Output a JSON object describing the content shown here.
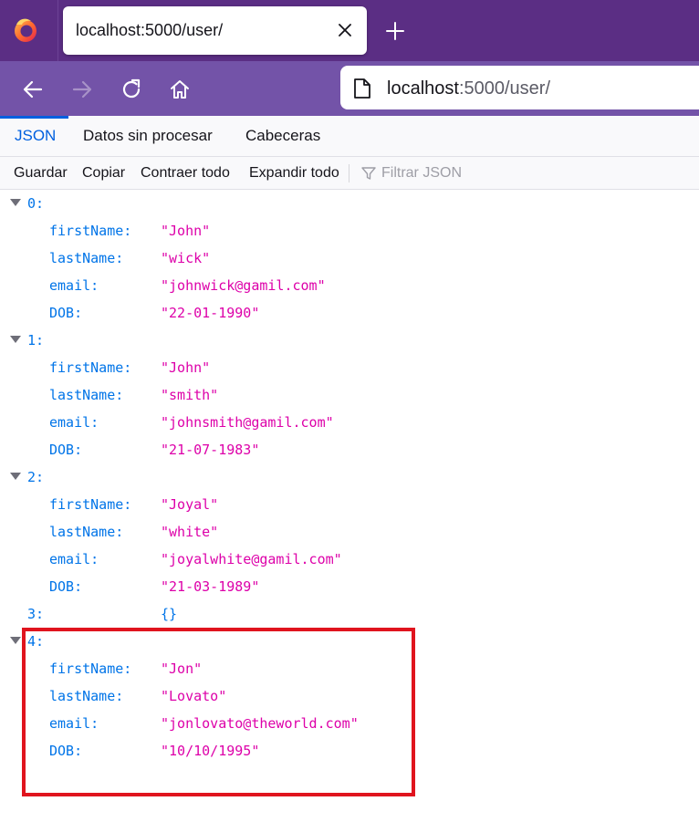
{
  "browser": {
    "tab_title": "localhost:5000/user/",
    "url_host": "localhost",
    "url_rest": ":5000/user/",
    "colors": {
      "tabbar": "#5b2e84",
      "navbar": "#7353a8",
      "accent": "#0060df"
    }
  },
  "json_viewer": {
    "tabs": [
      {
        "label": "JSON",
        "active": true
      },
      {
        "label": "Datos sin procesar",
        "active": false
      },
      {
        "label": "Cabeceras",
        "active": false
      }
    ],
    "toolbar": {
      "save": "Guardar",
      "copy": "Copiar",
      "collapse_all": "Contraer todo",
      "expand_all": "Expandir todo",
      "filter_placeholder": "Filtrar JSON"
    },
    "rows": [
      {
        "type": "index",
        "label": "0:"
      },
      {
        "type": "field",
        "key": "firstName:",
        "value": "\"John\""
      },
      {
        "type": "field",
        "key": "lastName:",
        "value": "\"wick\""
      },
      {
        "type": "field",
        "key": "email:",
        "value": "\"johnwick@gamil.com\""
      },
      {
        "type": "field",
        "key": "DOB:",
        "value": "\"22-01-1990\""
      },
      {
        "type": "index",
        "label": "1:"
      },
      {
        "type": "field",
        "key": "firstName:",
        "value": "\"John\""
      },
      {
        "type": "field",
        "key": "lastName:",
        "value": "\"smith\""
      },
      {
        "type": "field",
        "key": "email:",
        "value": "\"johnsmith@gamil.com\""
      },
      {
        "type": "field",
        "key": "DOB:",
        "value": "\"21-07-1983\""
      },
      {
        "type": "index",
        "label": "2:"
      },
      {
        "type": "field",
        "key": "firstName:",
        "value": "\"Joyal\""
      },
      {
        "type": "field",
        "key": "lastName:",
        "value": "\"white\""
      },
      {
        "type": "field",
        "key": "email:",
        "value": "\"joyalwhite@gamil.com\""
      },
      {
        "type": "field",
        "key": "DOB:",
        "value": "\"21-03-1989\""
      },
      {
        "type": "empty",
        "label": "3:",
        "value": "{}"
      },
      {
        "type": "index",
        "label": "4:"
      },
      {
        "type": "field",
        "key": "firstName:",
        "value": "\"Jon\""
      },
      {
        "type": "field",
        "key": "lastName:",
        "value": "\"Lovato\""
      },
      {
        "type": "field",
        "key": "email:",
        "value": "\"jonlovato@theworld.com\""
      },
      {
        "type": "field",
        "key": "DOB:",
        "value": "\"10/10/1995\""
      }
    ],
    "highlight_color": "#e0141e"
  }
}
